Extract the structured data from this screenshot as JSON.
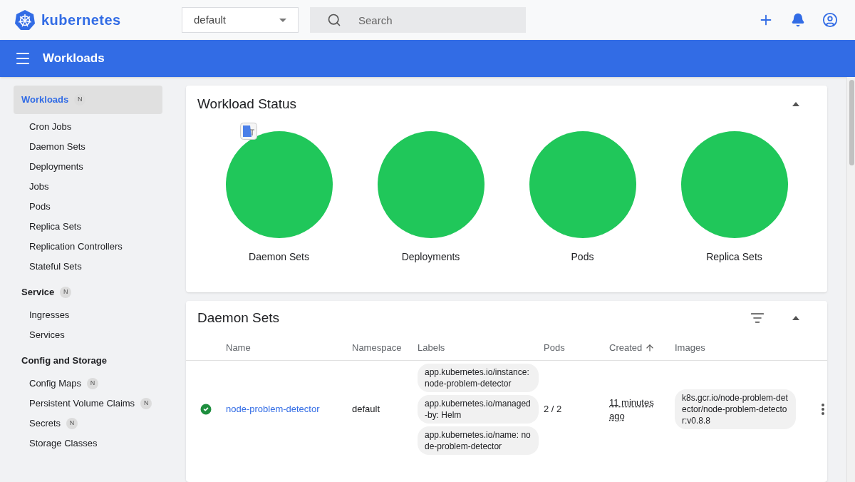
{
  "header": {
    "logo_text": "kubernetes",
    "namespace": "default",
    "search": {
      "placeholder": "Search"
    }
  },
  "toolbar": {
    "title": "Workloads"
  },
  "sidebar": {
    "sections": [
      {
        "title": "Workloads",
        "badge": "N",
        "selected": true,
        "children": [
          {
            "label": "Cron Jobs",
            "selected": false
          },
          {
            "label": "Daemon Sets",
            "selected": false
          },
          {
            "label": "Deployments",
            "selected": false
          },
          {
            "label": "Jobs",
            "selected": false
          },
          {
            "label": "Pods",
            "selected": false
          },
          {
            "label": "Replica Sets",
            "selected": false
          },
          {
            "label": "Replication Controllers",
            "selected": false
          },
          {
            "label": "Stateful Sets",
            "selected": false
          }
        ]
      },
      {
        "title": "Service",
        "badge": "N",
        "selected": false,
        "children": [
          {
            "label": "Ingresses",
            "selected": false
          },
          {
            "label": "Services",
            "selected": false
          }
        ]
      },
      {
        "title": "Config and Storage",
        "selected": false,
        "children": [
          {
            "label": "Config Maps",
            "badge": "N",
            "selected": false
          },
          {
            "label": "Persistent Volume Claims",
            "badge": "N",
            "selected": false
          },
          {
            "label": "Secrets",
            "badge": "N",
            "selected": false
          },
          {
            "label": "Storage Classes",
            "selected": false
          }
        ]
      }
    ]
  },
  "workload_status": {
    "title": "Workload Status",
    "expanded": true,
    "items": [
      {
        "label": "Daemon Sets"
      },
      {
        "label": "Deployments"
      },
      {
        "label": "Pods"
      },
      {
        "label": "Replica Sets"
      }
    ]
  },
  "daemon_sets": {
    "title": "Daemon Sets",
    "expanded": true,
    "columns": [
      {
        "label": "Name",
        "sorted": false
      },
      {
        "label": "Namespace",
        "sorted": false
      },
      {
        "label": "Labels",
        "sorted": false
      },
      {
        "label": "Pods",
        "sorted": false
      },
      {
        "label": "Created",
        "sorted": true
      },
      {
        "label": "Images",
        "sorted": false
      }
    ],
    "rows": [
      {
        "kind": "running",
        "name": "node-problem-detector",
        "namespace": "default",
        "labels": [
          "app.kubernetes.io/instance: node-problem-detector",
          "app.kubernetes.io/managed-by: Helm",
          "app.kubernetes.io/name: node-problem-detector"
        ],
        "pods": "2 / 2",
        "created": "11 minutes ago",
        "images": [
          "k8s.gcr.io/node-problem-detector/node-problem-detector:v0.8.8"
        ]
      }
    ]
  }
}
